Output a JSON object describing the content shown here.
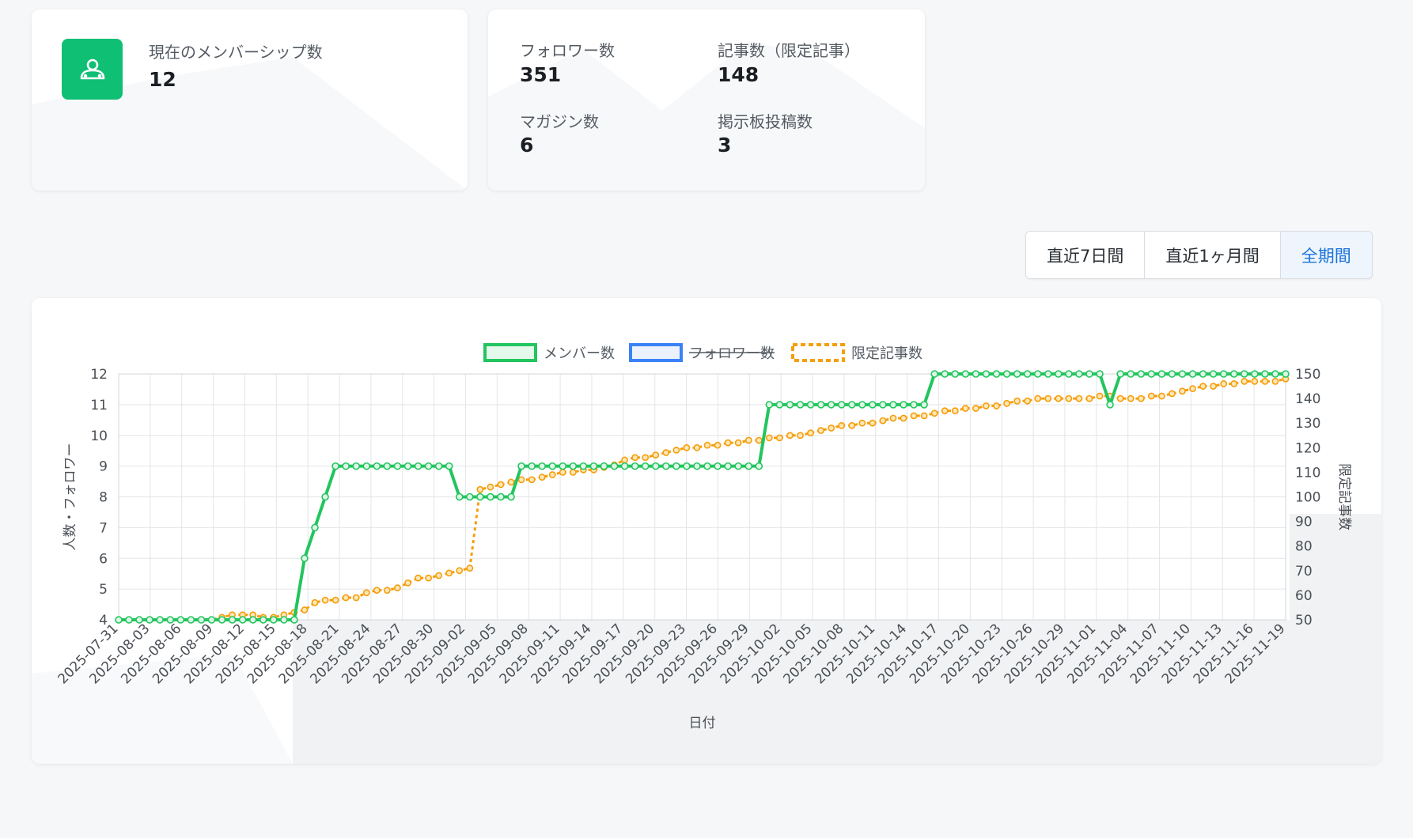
{
  "cards": {
    "membership": {
      "label": "現在のメンバーシップ数",
      "value": "12",
      "icon": "users-icon"
    },
    "stats": [
      {
        "label": "フォロワー数",
        "value": "351"
      },
      {
        "label": "記事数（限定記事）",
        "value": "148"
      },
      {
        "label": "マガジン数",
        "value": "6"
      },
      {
        "label": "掲示板投稿数",
        "value": "3"
      }
    ]
  },
  "range_buttons": [
    {
      "label": "直近7日間",
      "active": false
    },
    {
      "label": "直近1ヶ月間",
      "active": false
    },
    {
      "label": "全期間",
      "active": true
    }
  ],
  "colors": {
    "accent": "#0fbf74",
    "members": "#22c55e",
    "followers": "#3b82f6",
    "articles": "#f59e0b",
    "active_button": "#1a73d9"
  },
  "chart_data": {
    "type": "line",
    "xlabel": "日付",
    "ylabel_left": "人数・フォロワー",
    "ylabel_right": "限定記事数",
    "ylim_left": [
      4,
      12
    ],
    "ylim_right": [
      50,
      150
    ],
    "x_start": "2025-07-31",
    "x_end": "2025-11-19",
    "tick_labels": [
      "2025-07-31",
      "2025-08-03",
      "2025-08-06",
      "2025-08-09",
      "2025-08-12",
      "2025-08-15",
      "2025-08-18",
      "2025-08-21",
      "2025-08-24",
      "2025-08-27",
      "2025-08-30",
      "2025-09-02",
      "2025-09-05",
      "2025-09-08",
      "2025-09-11",
      "2025-09-14",
      "2025-09-17",
      "2025-09-20",
      "2025-09-23",
      "2025-09-26",
      "2025-09-29",
      "2025-10-02",
      "2025-10-05",
      "2025-10-08",
      "2025-10-11",
      "2025-10-14",
      "2025-10-17",
      "2025-10-20",
      "2025-10-23",
      "2025-10-26",
      "2025-10-29",
      "2025-11-01",
      "2025-11-04",
      "2025-11-07",
      "2025-11-10",
      "2025-11-13",
      "2025-11-16",
      "2025-11-19"
    ],
    "legend": [
      {
        "name": "メンバー数",
        "style": "solid",
        "color": "#22c55e",
        "hidden": false
      },
      {
        "name": "フォロワー数",
        "style": "solid",
        "color": "#3b82f6",
        "hidden": true
      },
      {
        "name": "限定記事数",
        "style": "dotted",
        "color": "#f59e0b",
        "hidden": false
      }
    ],
    "series": [
      {
        "name": "メンバー数",
        "axis": "left",
        "values": [
          4,
          4,
          4,
          4,
          4,
          4,
          4,
          4,
          4,
          4,
          4,
          4,
          4,
          4,
          4,
          4,
          4,
          4,
          6,
          7,
          8,
          9,
          9,
          9,
          9,
          9,
          9,
          9,
          9,
          9,
          9,
          9,
          9,
          8,
          8,
          8,
          8,
          8,
          8,
          9,
          9,
          9,
          9,
          9,
          9,
          9,
          9,
          9,
          9,
          9,
          9,
          9,
          9,
          9,
          9,
          9,
          9,
          9,
          9,
          9,
          9,
          9,
          9,
          11,
          11,
          11,
          11,
          11,
          11,
          11,
          11,
          11,
          11,
          11,
          11,
          11,
          11,
          11,
          11,
          12,
          12,
          12,
          12,
          12,
          12,
          12,
          12,
          12,
          12,
          12,
          12,
          12,
          12,
          12,
          12,
          12,
          11,
          12,
          12,
          12,
          12,
          12,
          12,
          12,
          12,
          12,
          12,
          12,
          12,
          12,
          12,
          12,
          12,
          12
        ]
      },
      {
        "name": "限定記事数",
        "axis": "right",
        "values": [
          50,
          50,
          50,
          50,
          50,
          50,
          50,
          50,
          50,
          50,
          51,
          52,
          52,
          52,
          51,
          51,
          52,
          53,
          54,
          57,
          58,
          58,
          59,
          59,
          61,
          62,
          62,
          63,
          65,
          67,
          67,
          68,
          69,
          70,
          71,
          103,
          104,
          105,
          106,
          107,
          107,
          108,
          109,
          110,
          110,
          111,
          111,
          112,
          113,
          115,
          116,
          116,
          117,
          118,
          119,
          120,
          120,
          121,
          121,
          122,
          122,
          123,
          123,
          124,
          124,
          125,
          125,
          126,
          127,
          128,
          129,
          129,
          130,
          130,
          131,
          132,
          132,
          133,
          133,
          134,
          135,
          135,
          136,
          136,
          137,
          137,
          138,
          139,
          139,
          140,
          140,
          140,
          140,
          140,
          140,
          141,
          141,
          140,
          140,
          140,
          141,
          141,
          142,
          143,
          144,
          145,
          145,
          146,
          146,
          147,
          147,
          147,
          147,
          148
        ]
      }
    ]
  }
}
